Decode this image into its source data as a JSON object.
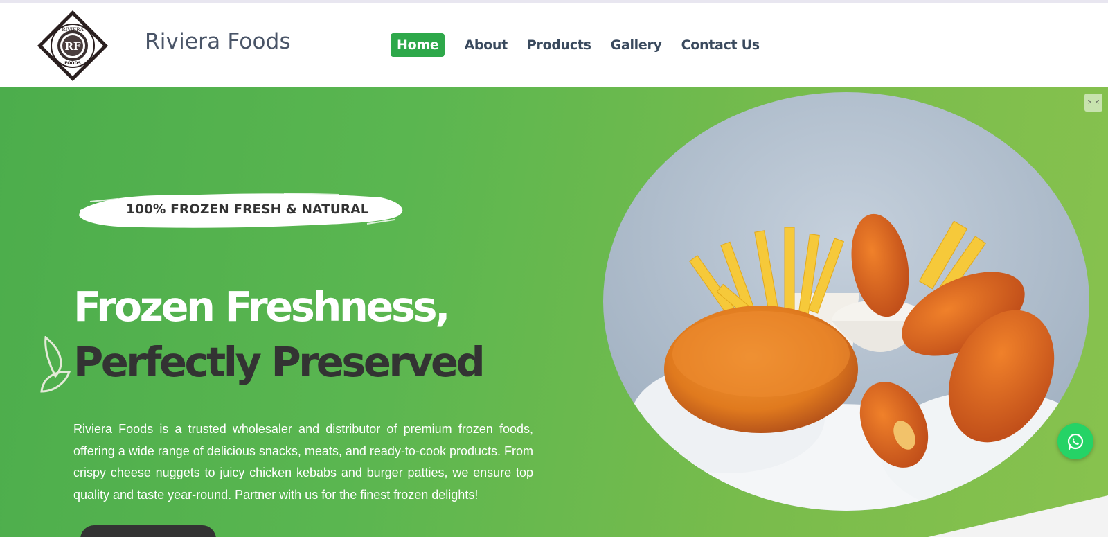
{
  "brand": {
    "name": "Riviera Foods",
    "logo_top_text": "RIVIERA",
    "logo_monogram": "RF",
    "logo_bottom_text": "FOODS"
  },
  "nav": {
    "items": [
      {
        "label": "Home",
        "active": true
      },
      {
        "label": "About",
        "active": false
      },
      {
        "label": "Products",
        "active": false
      },
      {
        "label": "Gallery",
        "active": false
      },
      {
        "label": "Contact Us",
        "active": false
      }
    ]
  },
  "hero": {
    "tagline": "100% FROZEN FRESH & NATURAL",
    "headline_line1": "Frozen Freshness,",
    "headline_line2": "Perfectly Preserved",
    "description": "Riviera Foods is a trusted wholesaler and distributor of premium frozen foods, offering a wide range of delicious snacks, meats, and ready-to-cook products. From crispy cheese nuggets to juicy chicken kebabs and burger patties, we ensure top quality and taste year-round. Partner with us for the finest frozen delights!",
    "corner_button_glyph": ">_<"
  },
  "icons": {
    "whatsapp": "whatsapp-icon",
    "leaf": "leaf-icon",
    "corner": "expand-icon"
  },
  "colors": {
    "accent_green": "#2ea84a",
    "hero_green": "#5ab650",
    "dark_text": "#333333",
    "nav_text": "#3a4a5e",
    "whatsapp_green": "#25d366"
  }
}
